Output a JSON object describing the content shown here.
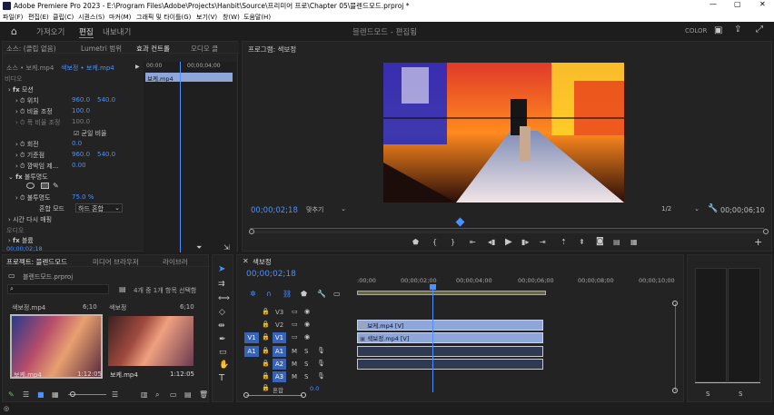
{
  "titlebar": {
    "title": "Adobe Premiere Pro 2023 - E:\\Program Files\\Adobe\\Projects\\Hanbit\\Source\\프리미어 프로\\Chapter 05\\블렌드모드.prproj *"
  },
  "menu": [
    "파일(F)",
    "편집(E)",
    "클립(C)",
    "시퀀스(S)",
    "마커(M)",
    "그래픽 및 타이틀(G)",
    "보기(V)",
    "창(W)",
    "도움말(H)"
  ],
  "workspace": {
    "tabs": [
      "가져오기",
      "편집",
      "내보내기"
    ],
    "center": "블렌드모드 - 편집됨",
    "color": "COLOR"
  },
  "effects": {
    "tabs": [
      "소스: (클립 없음)",
      "Lumetri 범위",
      "효과 컨트롤",
      "오디오 클"
    ],
    "source": "소스 • 보케.mp4",
    "seq": "색보정 • 보케.mp4",
    "time_start": "00:00",
    "time_end": "00;00;04;00",
    "clip": "보케.mp4",
    "video_label": "비디오",
    "rows": [
      {
        "name": "모션"
      },
      {
        "name": "위치",
        "v1": "960.0",
        "v2": "540.0"
      },
      {
        "name": "비율 조정",
        "v1": "100.0"
      },
      {
        "name": "폭 비율 조정",
        "v1": "100.0"
      },
      {
        "name": "균일 비율"
      },
      {
        "name": "회전",
        "v1": "0.0"
      },
      {
        "name": "기준점",
        "v1": "960.0",
        "v2": "540.0"
      },
      {
        "name": "깜박임 제...",
        "v1": "0.00"
      },
      {
        "name": "불투명도"
      },
      {
        "name": "불투명도",
        "v1": "75.0 %"
      },
      {
        "name": "혼합 모드",
        "v1": "하드 혼합"
      },
      {
        "name": "시간 다시 매핑"
      },
      {
        "name": "오디오"
      },
      {
        "name": "볼륨"
      }
    ],
    "timecode": "00;00;02;18"
  },
  "program": {
    "tab": "프로그램: 색보정",
    "timecode": "00;00;02;18",
    "fit": "맞추기",
    "res": "1/2",
    "duration": "00;00;06;10"
  },
  "project": {
    "tabs": [
      "프로젝트: 블렌드모드",
      "미디어 브라우저",
      "라이브러"
    ],
    "file": "블렌드모드.prproj",
    "search_placeholder": "",
    "count": "4개 중 1개 항목 선택함",
    "items": [
      {
        "name": "색보정.mp4",
        "dur": "6;10",
        "sub": "보케.mp4",
        "time": "1:12:05"
      },
      {
        "name": "색보정",
        "dur": "6;10",
        "sub": "보케.mp4",
        "time": "1:12:05"
      }
    ]
  },
  "timeline": {
    "tab": "색보정",
    "timecode": "00;00;02;18",
    "ruler": [
      ":00;00",
      "00;00;02;00",
      "00;00;04;00",
      "00;00;06;00",
      "00;00;08;00",
      "00;00;10;00"
    ],
    "tracks": [
      {
        "id": "V3",
        "src": ""
      },
      {
        "id": "V2",
        "src": ""
      },
      {
        "id": "V1",
        "src": "V1"
      },
      {
        "id": "A1",
        "src": "A1"
      },
      {
        "id": "A2",
        "src": ""
      },
      {
        "id": "A3",
        "src": ""
      }
    ],
    "master": "혼합",
    "master_val": "0.0",
    "clips": {
      "v2": "보케.mp4 [V]",
      "v1": "색보정.mp4 [V]"
    }
  },
  "meter": {
    "labels": [
      "0",
      "-6",
      "-12",
      "-18",
      "-24",
      "-30",
      "-36",
      "-42",
      "-48",
      "-54",
      "dB"
    ],
    "s1": "S",
    "s2": "S"
  }
}
